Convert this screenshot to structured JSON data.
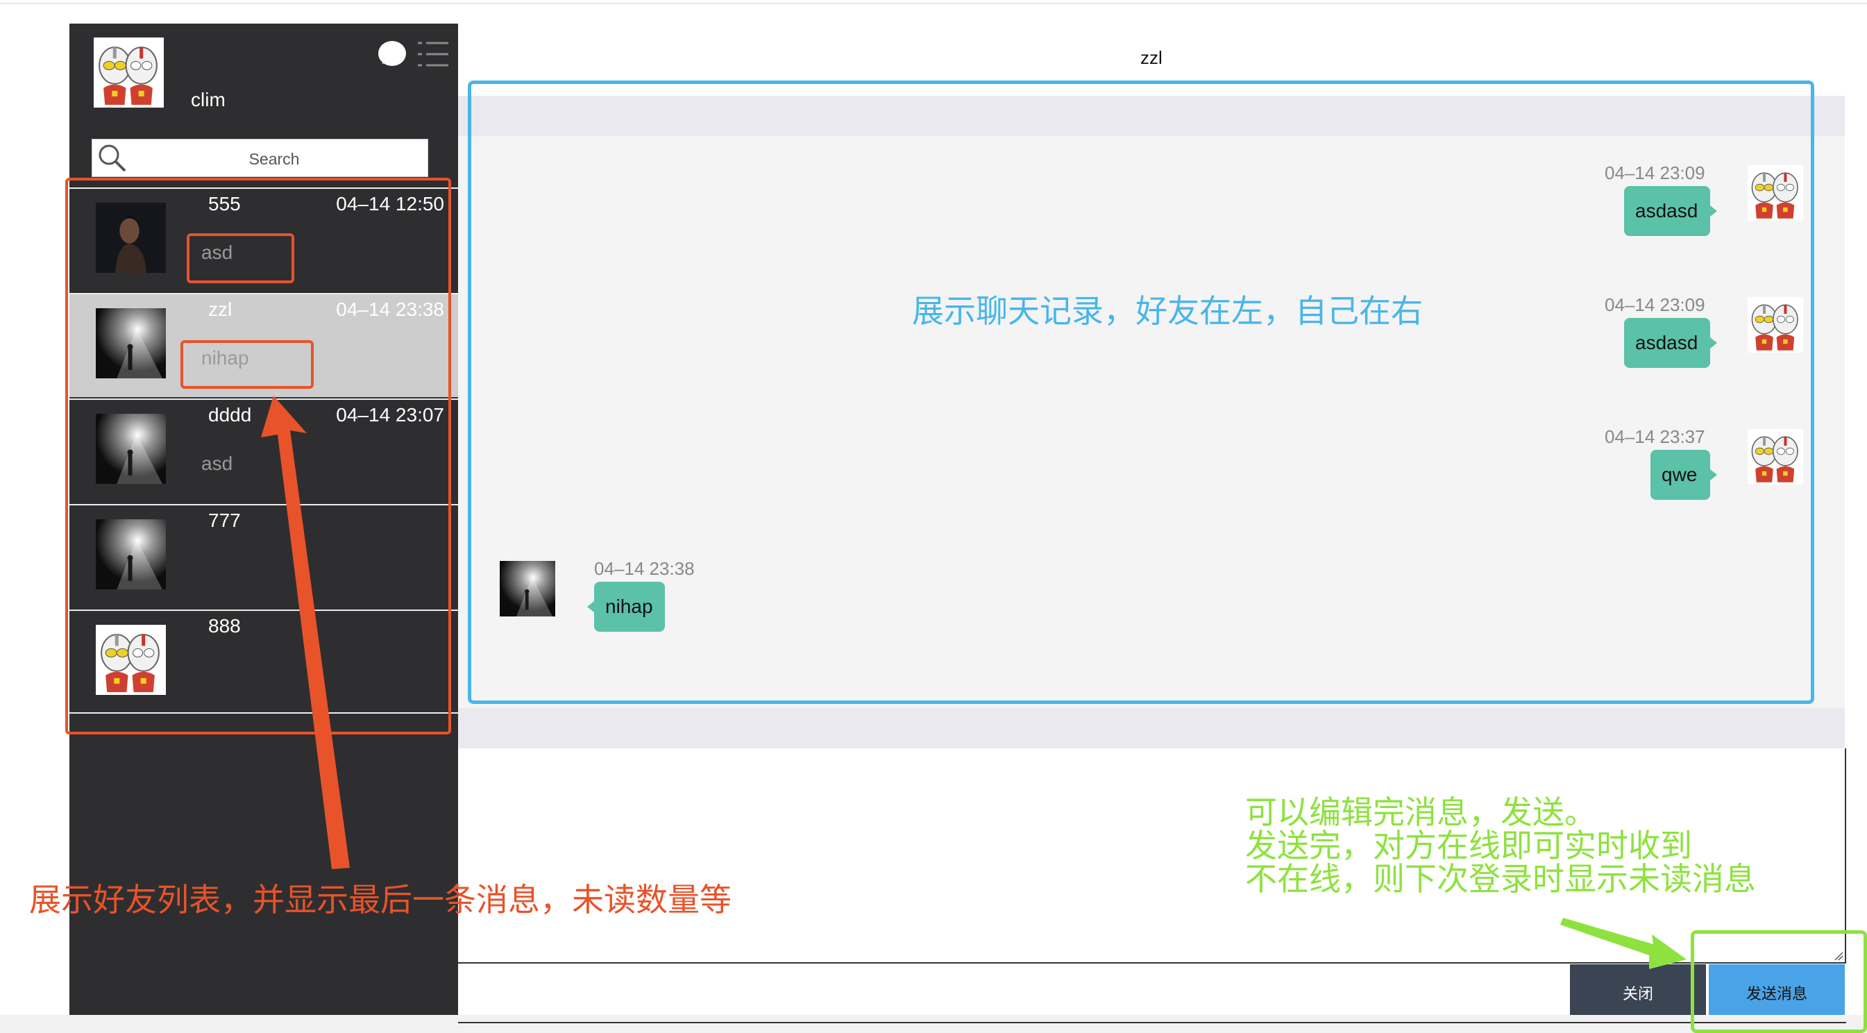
{
  "me": {
    "name": "clim",
    "avatar": "ultraman-avatar"
  },
  "header_icons": {
    "chat": "chat-bubble-icon",
    "menu": "list-menu-icon"
  },
  "search": {
    "placeholder": "Search",
    "icon": "search-icon"
  },
  "friends": [
    {
      "name": "555",
      "time": "04–14 12:50",
      "last": "asd",
      "avatar": "dark-portrait-avatar",
      "active": false
    },
    {
      "name": "zzl",
      "time": "04–14 23:38",
      "last": "nihap",
      "avatar": "spotlight-avatar",
      "active": true
    },
    {
      "name": "dddd",
      "time": "04–14 23:07",
      "last": "asd",
      "avatar": "spotlight-avatar",
      "active": false
    },
    {
      "name": "777",
      "time": "",
      "last": "",
      "avatar": "spotlight-avatar",
      "active": false
    },
    {
      "name": "888",
      "time": "",
      "last": "",
      "avatar": "ultraman-avatar",
      "active": false
    }
  ],
  "chat": {
    "title": "zzl",
    "messages": [
      {
        "side": "right",
        "time": "04–14 23:09",
        "text": "asdasd"
      },
      {
        "side": "right",
        "time": "04–14 23:09",
        "text": "asdasd"
      },
      {
        "side": "right",
        "time": "04–14 23:37",
        "text": "qwe"
      },
      {
        "side": "left",
        "time": "04–14 23:38",
        "text": "nihap"
      }
    ]
  },
  "buttons": {
    "close": "关闭",
    "send": "发送消息"
  },
  "annotations": {
    "friend_list": "展示好友列表，并显示最后一条消息，未读数量等",
    "chat_history": "展示聊天记录，好友在左，自己在右",
    "send_info": [
      "可以编辑完消息，发送。",
      "发送完，对方在线即可实时收到",
      "不在线，则下次登录时显示未读消息"
    ]
  },
  "colors": {
    "sidebar": "#2e2e30",
    "bubble": "#5bc1a9",
    "annotation_red": "#e8532a",
    "annotation_blue": "#47b6ea",
    "annotation_green": "#8de23f",
    "send_button": "#4aa3e6",
    "close_button": "#3b4452"
  }
}
